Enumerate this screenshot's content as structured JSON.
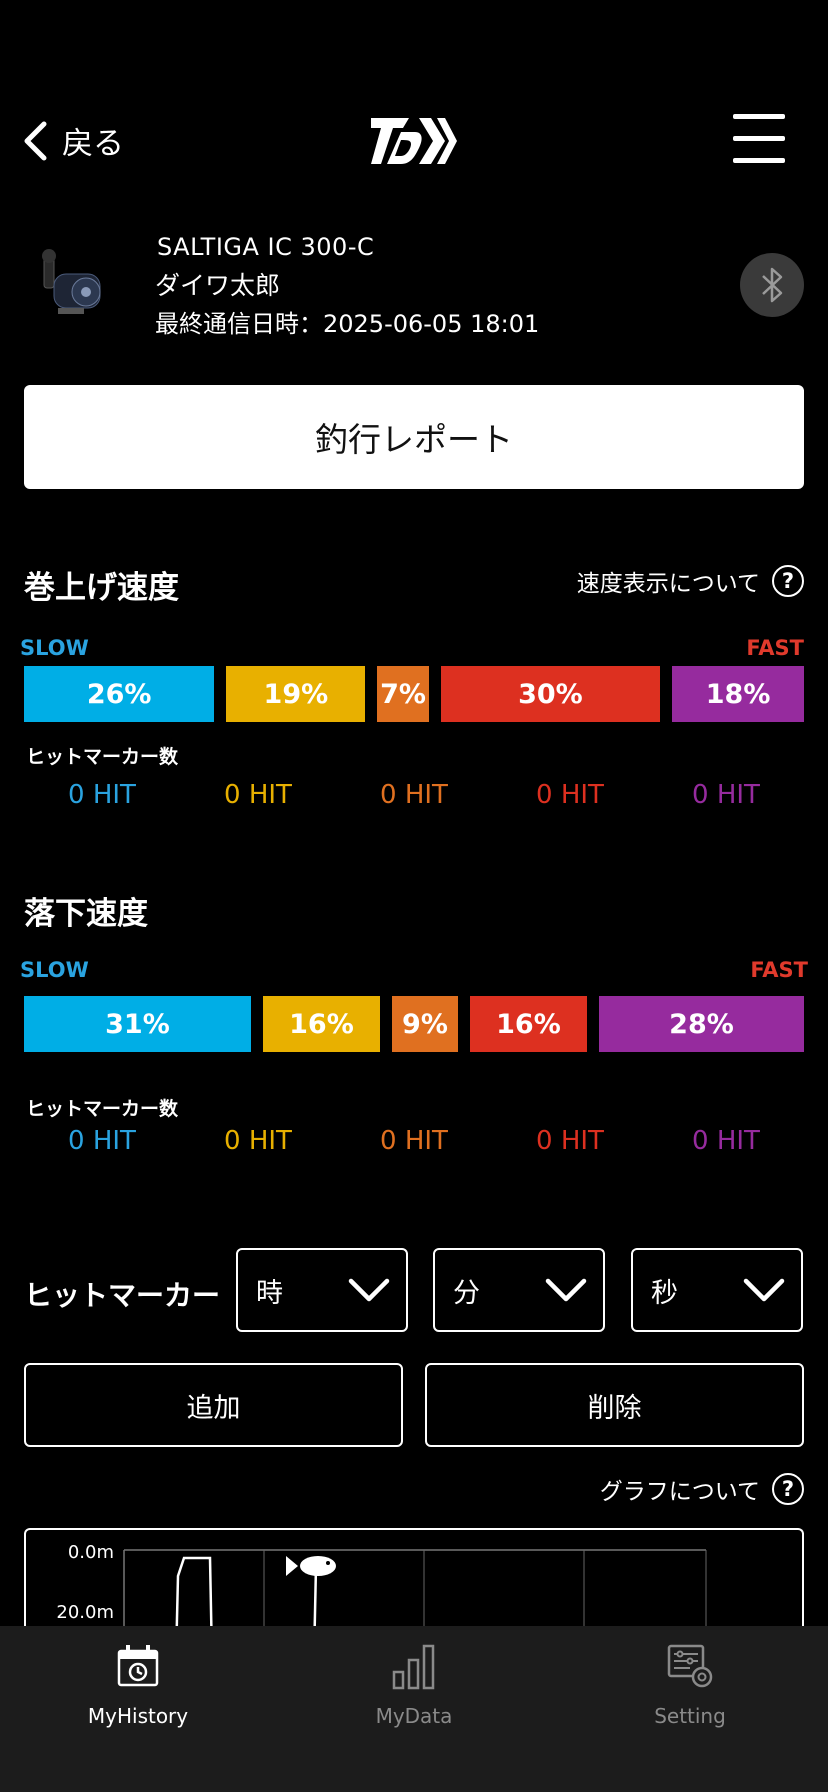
{
  "header": {
    "back_label": "戻る"
  },
  "device": {
    "model": "SALTIGA IC 300-C",
    "owner": "ダイワ太郎",
    "last_comm": "最終通信日時：2025-06-05 18:01"
  },
  "report_button": "釣行レポート",
  "winding": {
    "title": "巻上げ速度",
    "help": "速度表示について",
    "slow": "SLOW",
    "fast": "FAST",
    "segments": [
      {
        "label": "26%",
        "value": 26,
        "color": "#00aee6"
      },
      {
        "label": "19%",
        "value": 19,
        "color": "#e8b000"
      },
      {
        "label": "7%",
        "value": 7,
        "color": "#e07020"
      },
      {
        "label": "30%",
        "value": 30,
        "color": "#dd3020"
      },
      {
        "label": "18%",
        "value": 18,
        "color": "#962b9e"
      }
    ],
    "hit_label": "ヒットマーカー数",
    "hits": [
      "0 HIT",
      "0 HIT",
      "0 HIT",
      "0 HIT",
      "0 HIT"
    ]
  },
  "falling": {
    "title": "落下速度",
    "slow": "SLOW",
    "fast": "FAST",
    "segments": [
      {
        "label": "31%",
        "value": 31,
        "color": "#00aee6"
      },
      {
        "label": "16%",
        "value": 16,
        "color": "#e8b000"
      },
      {
        "label": "9%",
        "value": 9,
        "color": "#e07020"
      },
      {
        "label": "16%",
        "value": 16,
        "color": "#dd3020"
      },
      {
        "label": "28%",
        "value": 28,
        "color": "#962b9e"
      }
    ],
    "hit_label": "ヒットマーカー数",
    "hits": [
      "0 HIT",
      "0 HIT",
      "0 HIT",
      "0 HIT",
      "0 HIT"
    ]
  },
  "hit_colors": [
    "#2aa3e0",
    "#e8b000",
    "#e07020",
    "#dd3020",
    "#962b9e"
  ],
  "hitmarker": {
    "title": "ヒットマーカー",
    "hour": "時",
    "minute": "分",
    "second": "秒",
    "add": "追加",
    "delete": "削除"
  },
  "graph": {
    "help": "グラフについて",
    "y_labels": [
      "0.0m",
      "20.0m"
    ]
  },
  "tabs": [
    {
      "label": "MyHistory",
      "active": true,
      "icon": "calendar-history-icon"
    },
    {
      "label": "MyData",
      "active": false,
      "icon": "bar-chart-icon"
    },
    {
      "label": "Setting",
      "active": false,
      "icon": "settings-icon"
    }
  ],
  "colors": {
    "tab_active": "#ffffff",
    "tab_inactive": "#8a8a8a"
  }
}
